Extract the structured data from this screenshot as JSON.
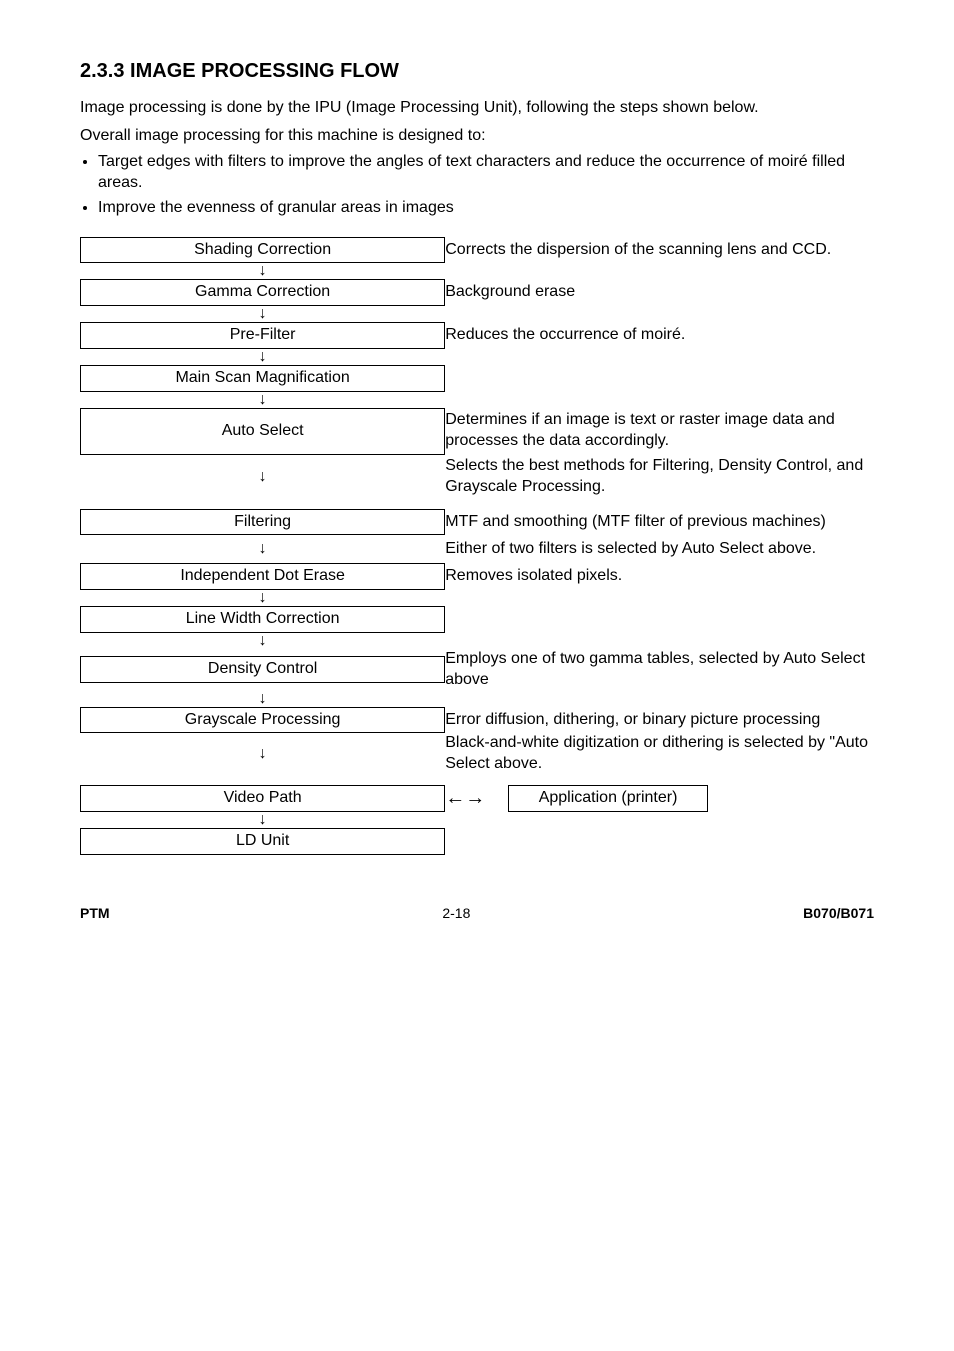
{
  "heading": "2.3.3  IMAGE PROCESSING FLOW",
  "intro1": "Image processing is done by the IPU (Image Processing Unit), following the steps shown below.",
  "intro2": "Overall image processing for this machine is designed to:",
  "bullets": {
    "b1": "Target edges with filters to improve the angles of text characters and reduce the occurrence of moiré filled areas.",
    "b2": "Improve the evenness of granular areas in images"
  },
  "rows": {
    "shading_label": "Shading Correction",
    "shading_desc": "Corrects the dispersion of the scanning lens and CCD.",
    "gamma_label": "Gamma Correction",
    "gamma_desc": "Background erase",
    "prefilter_label": "Pre-Filter",
    "prefilter_desc": "Reduces the occurrence of moiré.",
    "mainscan_label": "Main Scan Magnification",
    "autoselect_label": "Auto Select",
    "autoselect_desc": "Determines if an image is text or raster image data and processes the data accordingly.",
    "autoselect_arrow_desc": "Selects the best methods for Filtering, Density Control, and Grayscale Processing.",
    "filtering_label": "Filtering",
    "filtering_desc": "MTF and smoothing (MTF filter of previous machines)",
    "filtering_arrow_desc": "Either of two filters is selected by Auto Select above.",
    "indep_label": "Independent Dot Erase",
    "indep_desc": "Removes isolated pixels.",
    "linewidth_label": "Line Width Correction",
    "density_label": "Density Control",
    "density_desc": "Employs one of two gamma tables, selected by Auto Select above",
    "grayscale_label": "Grayscale Processing",
    "grayscale_desc": "Error diffusion, dithering, or binary picture processing",
    "grayscale_arrow_desc": "Black-and-white digitization or dithering is selected by \"Auto Select above.",
    "video_label": "Video Path",
    "app_label": "Application (printer)",
    "ld_label": "LD Unit"
  },
  "arrows": {
    "down": "↓",
    "bidir": "←→"
  },
  "footer": {
    "left": "PTM",
    "center": "2-18",
    "right": "B070/B071"
  }
}
